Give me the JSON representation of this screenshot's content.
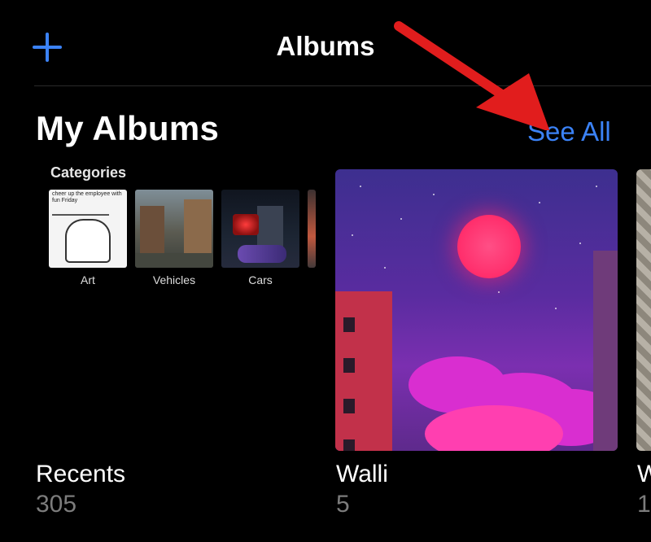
{
  "nav": {
    "title": "Albums",
    "add_icon": "plus-icon"
  },
  "section": {
    "title": "My Albums",
    "see_all": "See All"
  },
  "colors": {
    "accent": "#3b82f6",
    "background": "#000000",
    "annotation": "#e11d1d"
  },
  "categories": {
    "title": "Categories",
    "items": [
      {
        "label": "Art",
        "caption": "cheer up the employee with fun Friday"
      },
      {
        "label": "Vehicles"
      },
      {
        "label": "Cars"
      }
    ]
  },
  "albums": [
    {
      "name": "Recents",
      "count": "305"
    },
    {
      "name": "Walli",
      "count": "5"
    },
    {
      "name": "W",
      "count": "1"
    }
  ]
}
